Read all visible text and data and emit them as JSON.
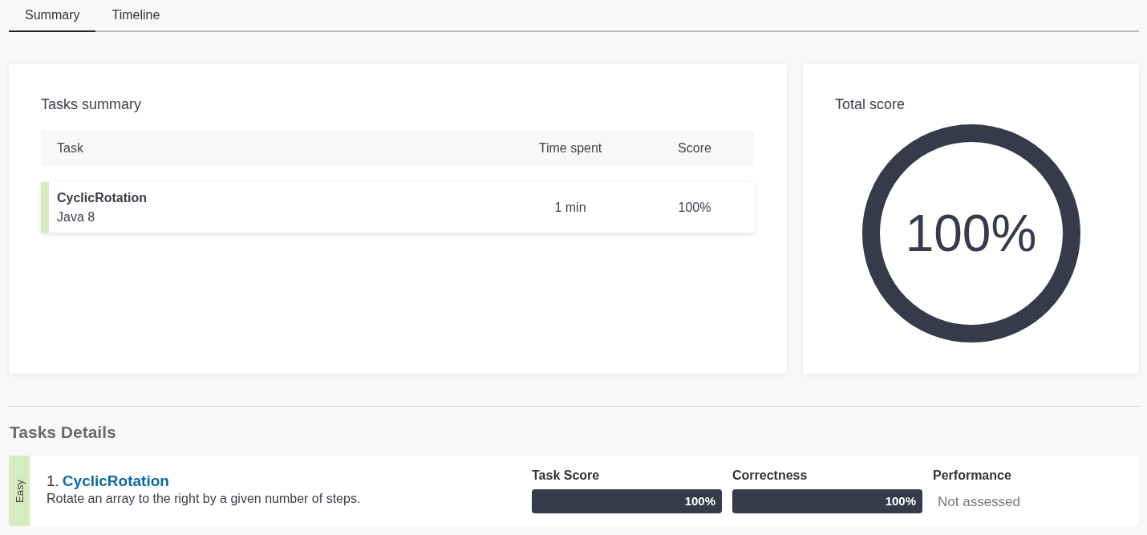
{
  "tabs": [
    {
      "label": "Summary",
      "selected": true
    },
    {
      "label": "Timeline",
      "selected": false
    }
  ],
  "tasks_summary": {
    "title": "Tasks summary",
    "columns": [
      "Task",
      "Time spent",
      "Score"
    ],
    "rows": [
      {
        "name": "CyclicRotation",
        "language": "Java 8",
        "time_spent": "1 min",
        "score": "100%",
        "color": "#d4ecbf"
      }
    ]
  },
  "total_score": {
    "title": "Total score",
    "value": "100%",
    "level": 1
  },
  "tasks_details": {
    "title": "Tasks Details",
    "tasks": [
      {
        "difficulty": "Easy",
        "color": "#d4ecbf",
        "number": "1.",
        "name": "CyclicRotation",
        "description": "Rotate an array to the right by a given number of steps.",
        "metrics": [
          {
            "kind": "bar",
            "label": "Task Score",
            "value": "100%",
            "level": 1
          },
          {
            "kind": "bar",
            "label": "Correctness",
            "value": "100%",
            "level": 1
          },
          {
            "kind": "text",
            "label": "Performance",
            "value": "Not assessed"
          }
        ]
      }
    ]
  }
}
